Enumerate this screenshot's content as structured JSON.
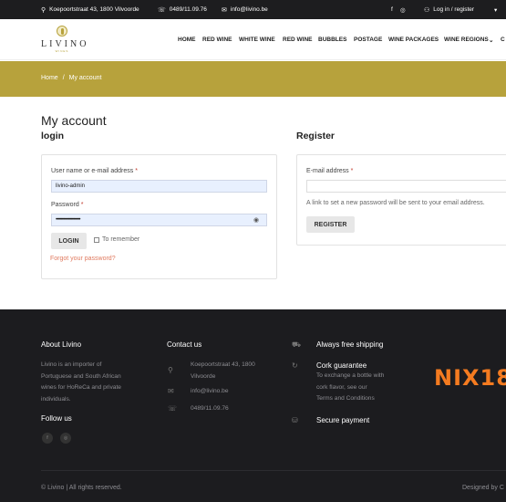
{
  "topbar": {
    "address": "Koepoortstraat 43, 1800 Vilvoorde",
    "phone": "0489/11.09.76",
    "email": "info@livino.be",
    "social_facebook": "f",
    "social_instagram": "◎",
    "login_register": "Log in / register",
    "cart_icon": "▾"
  },
  "header": {
    "logo_name": "LIVINO",
    "logo_sub": "WINES",
    "nav": [
      "HOME",
      "RED WINE",
      "WHITE WINE",
      "RED WINE",
      "BUBBLES",
      "POSTAGE",
      "WINE PACKAGES",
      "WINE REGIONS",
      "C"
    ],
    "nav_caret": "⌄"
  },
  "breadcrumb": {
    "home": "Home",
    "separator": "/",
    "current": "My account"
  },
  "page_title": "My account",
  "login": {
    "title": "login",
    "username_label": "User name or e-mail address",
    "username_value": "livino-admin",
    "password_label": "Password",
    "password_value": "••••••••••••••••••••••••",
    "required_mark": "*",
    "login_button": "LOGIN",
    "remember_label": "To remember",
    "forgot_link": "Forgot your password?"
  },
  "register": {
    "title": "Register",
    "email_label": "E-mail address",
    "required_mark": "*",
    "note": "A link to set a new password will be sent to your email address.",
    "register_button": "REGISTER"
  },
  "footer": {
    "about_title": "About Livino",
    "about_text_lines": [
      "Livino is an importer of",
      "Portuguese and South African",
      "wines for HoReCa and private",
      "individuals."
    ],
    "follow_title": "Follow us",
    "contact_title": "Contact us",
    "contact_address_lines": [
      "Koepoortstraat 43, 1800",
      "Vilvoorde"
    ],
    "contact_email": "info@livino.be",
    "contact_phone": "0489/11.09.76",
    "shipping_title": "Always free shipping",
    "cork_title": "Cork guarantee",
    "cork_text_lines": [
      "To exchange a bottle with",
      "cork flavor, see our",
      "Terms and Conditions"
    ],
    "payment_title": "Secure payment",
    "nix_logo": "NIX18",
    "copyright": "© Livino | All rights reserved.",
    "designed_by": "Designed by C"
  },
  "colors": {
    "accent": "#b7a23c",
    "footer_bg": "#1c1c1f",
    "topbar_bg": "#1d1d1f",
    "nix_orange": "#f47b20"
  }
}
